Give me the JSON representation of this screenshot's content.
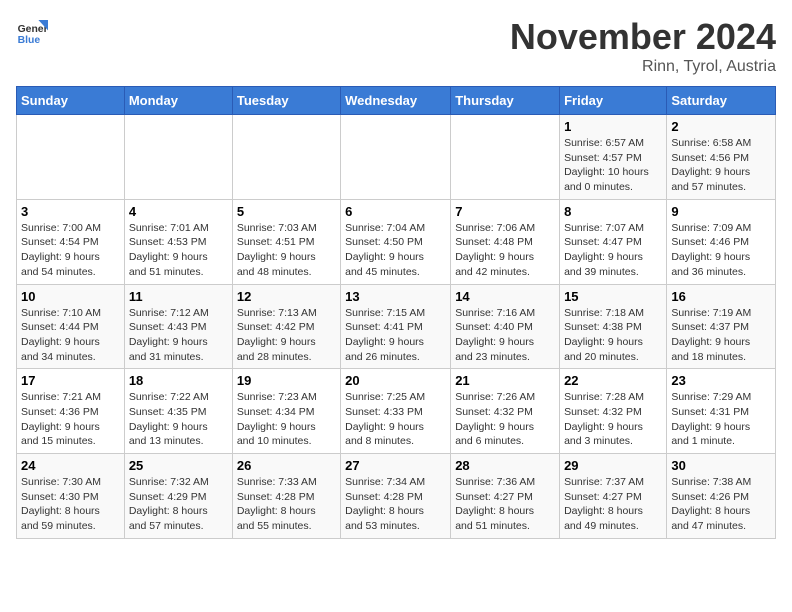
{
  "logo": {
    "line1": "General",
    "line2": "Blue"
  },
  "title": "November 2024",
  "location": "Rinn, Tyrol, Austria",
  "weekdays": [
    "Sunday",
    "Monday",
    "Tuesday",
    "Wednesday",
    "Thursday",
    "Friday",
    "Saturday"
  ],
  "weeks": [
    [
      {
        "day": "",
        "info": ""
      },
      {
        "day": "",
        "info": ""
      },
      {
        "day": "",
        "info": ""
      },
      {
        "day": "",
        "info": ""
      },
      {
        "day": "",
        "info": ""
      },
      {
        "day": "1",
        "info": "Sunrise: 6:57 AM\nSunset: 4:57 PM\nDaylight: 10 hours\nand 0 minutes."
      },
      {
        "day": "2",
        "info": "Sunrise: 6:58 AM\nSunset: 4:56 PM\nDaylight: 9 hours\nand 57 minutes."
      }
    ],
    [
      {
        "day": "3",
        "info": "Sunrise: 7:00 AM\nSunset: 4:54 PM\nDaylight: 9 hours\nand 54 minutes."
      },
      {
        "day": "4",
        "info": "Sunrise: 7:01 AM\nSunset: 4:53 PM\nDaylight: 9 hours\nand 51 minutes."
      },
      {
        "day": "5",
        "info": "Sunrise: 7:03 AM\nSunset: 4:51 PM\nDaylight: 9 hours\nand 48 minutes."
      },
      {
        "day": "6",
        "info": "Sunrise: 7:04 AM\nSunset: 4:50 PM\nDaylight: 9 hours\nand 45 minutes."
      },
      {
        "day": "7",
        "info": "Sunrise: 7:06 AM\nSunset: 4:48 PM\nDaylight: 9 hours\nand 42 minutes."
      },
      {
        "day": "8",
        "info": "Sunrise: 7:07 AM\nSunset: 4:47 PM\nDaylight: 9 hours\nand 39 minutes."
      },
      {
        "day": "9",
        "info": "Sunrise: 7:09 AM\nSunset: 4:46 PM\nDaylight: 9 hours\nand 36 minutes."
      }
    ],
    [
      {
        "day": "10",
        "info": "Sunrise: 7:10 AM\nSunset: 4:44 PM\nDaylight: 9 hours\nand 34 minutes."
      },
      {
        "day": "11",
        "info": "Sunrise: 7:12 AM\nSunset: 4:43 PM\nDaylight: 9 hours\nand 31 minutes."
      },
      {
        "day": "12",
        "info": "Sunrise: 7:13 AM\nSunset: 4:42 PM\nDaylight: 9 hours\nand 28 minutes."
      },
      {
        "day": "13",
        "info": "Sunrise: 7:15 AM\nSunset: 4:41 PM\nDaylight: 9 hours\nand 26 minutes."
      },
      {
        "day": "14",
        "info": "Sunrise: 7:16 AM\nSunset: 4:40 PM\nDaylight: 9 hours\nand 23 minutes."
      },
      {
        "day": "15",
        "info": "Sunrise: 7:18 AM\nSunset: 4:38 PM\nDaylight: 9 hours\nand 20 minutes."
      },
      {
        "day": "16",
        "info": "Sunrise: 7:19 AM\nSunset: 4:37 PM\nDaylight: 9 hours\nand 18 minutes."
      }
    ],
    [
      {
        "day": "17",
        "info": "Sunrise: 7:21 AM\nSunset: 4:36 PM\nDaylight: 9 hours\nand 15 minutes."
      },
      {
        "day": "18",
        "info": "Sunrise: 7:22 AM\nSunset: 4:35 PM\nDaylight: 9 hours\nand 13 minutes."
      },
      {
        "day": "19",
        "info": "Sunrise: 7:23 AM\nSunset: 4:34 PM\nDaylight: 9 hours\nand 10 minutes."
      },
      {
        "day": "20",
        "info": "Sunrise: 7:25 AM\nSunset: 4:33 PM\nDaylight: 9 hours\nand 8 minutes."
      },
      {
        "day": "21",
        "info": "Sunrise: 7:26 AM\nSunset: 4:32 PM\nDaylight: 9 hours\nand 6 minutes."
      },
      {
        "day": "22",
        "info": "Sunrise: 7:28 AM\nSunset: 4:32 PM\nDaylight: 9 hours\nand 3 minutes."
      },
      {
        "day": "23",
        "info": "Sunrise: 7:29 AM\nSunset: 4:31 PM\nDaylight: 9 hours\nand 1 minute."
      }
    ],
    [
      {
        "day": "24",
        "info": "Sunrise: 7:30 AM\nSunset: 4:30 PM\nDaylight: 8 hours\nand 59 minutes."
      },
      {
        "day": "25",
        "info": "Sunrise: 7:32 AM\nSunset: 4:29 PM\nDaylight: 8 hours\nand 57 minutes."
      },
      {
        "day": "26",
        "info": "Sunrise: 7:33 AM\nSunset: 4:28 PM\nDaylight: 8 hours\nand 55 minutes."
      },
      {
        "day": "27",
        "info": "Sunrise: 7:34 AM\nSunset: 4:28 PM\nDaylight: 8 hours\nand 53 minutes."
      },
      {
        "day": "28",
        "info": "Sunrise: 7:36 AM\nSunset: 4:27 PM\nDaylight: 8 hours\nand 51 minutes."
      },
      {
        "day": "29",
        "info": "Sunrise: 7:37 AM\nSunset: 4:27 PM\nDaylight: 8 hours\nand 49 minutes."
      },
      {
        "day": "30",
        "info": "Sunrise: 7:38 AM\nSunset: 4:26 PM\nDaylight: 8 hours\nand 47 minutes."
      }
    ]
  ]
}
